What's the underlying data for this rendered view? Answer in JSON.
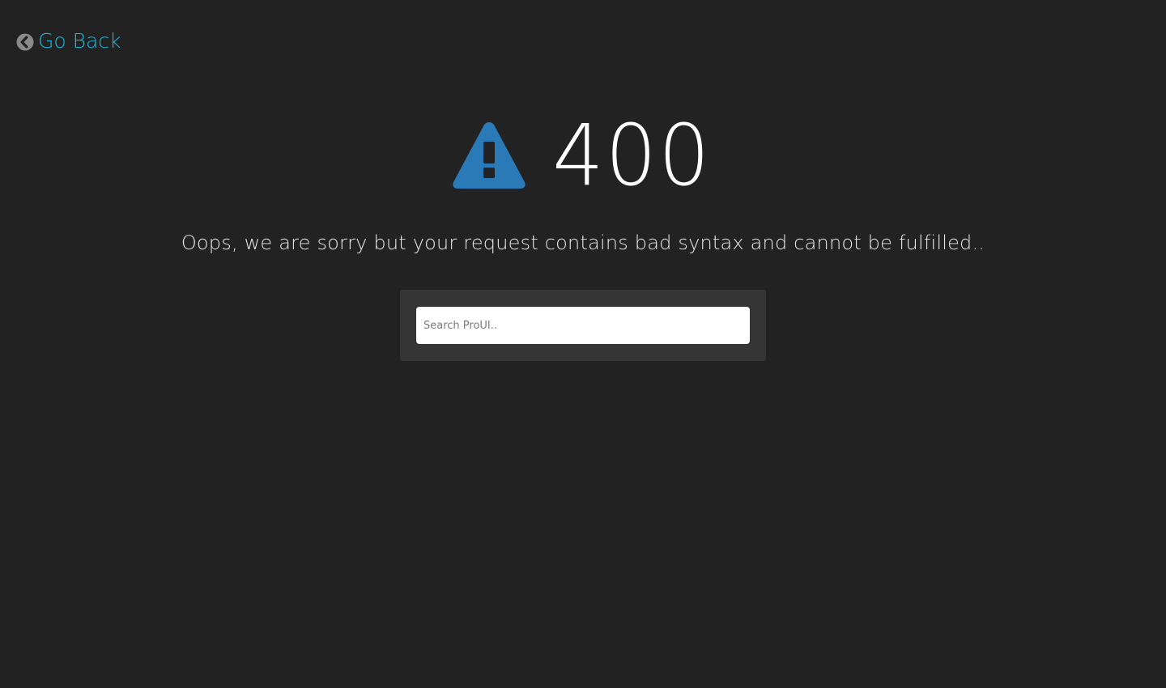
{
  "nav": {
    "go_back_label": "Go Back",
    "go_back_icon": "chevron-circle-left-icon"
  },
  "error": {
    "icon": "warning-triangle-icon",
    "code": "400",
    "message": "Oops, we are sorry but your request contains bad syntax and cannot be fulfilled.."
  },
  "search": {
    "placeholder": "Search ProUI..",
    "value": ""
  },
  "colors": {
    "background": "#222222",
    "link": "#1bbae1",
    "warning_icon": "#2a7ab8",
    "panel": "#353535",
    "code_text": "#ffffff",
    "message_text": "#e6e6e6"
  }
}
